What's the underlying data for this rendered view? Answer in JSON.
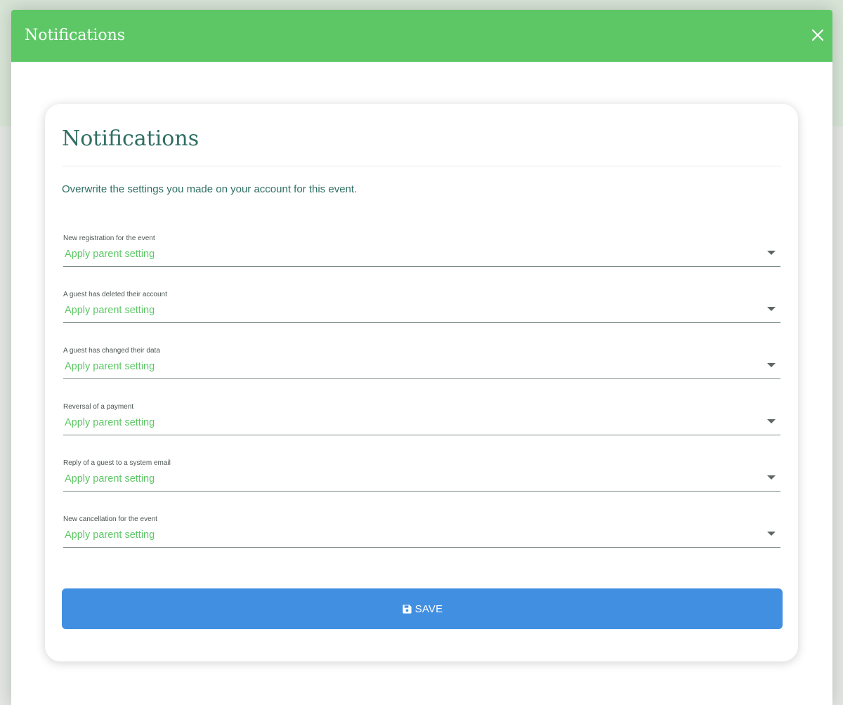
{
  "modal": {
    "title": "Notifications",
    "close_icon": "close-icon"
  },
  "card": {
    "title": "Notifications",
    "description": "Overwrite the settings you made on your account for this event."
  },
  "fields": [
    {
      "label": "New registration for the event",
      "value": "Apply parent setting"
    },
    {
      "label": "A guest has deleted their account",
      "value": "Apply parent setting"
    },
    {
      "label": "A guest has changed their data",
      "value": "Apply parent setting"
    },
    {
      "label": "Reversal of a payment",
      "value": "Apply parent setting"
    },
    {
      "label": "Reply of a guest to a system email",
      "value": "Apply parent setting"
    },
    {
      "label": "New cancellation for the event",
      "value": "Apply parent setting"
    }
  ],
  "save_button": {
    "label": "SAVE",
    "icon": "floppy-disk-icon"
  },
  "colors": {
    "header_green": "#5dc766",
    "title_teal": "#2f6e63",
    "value_green": "#5dc766",
    "button_blue": "#418fe1"
  }
}
